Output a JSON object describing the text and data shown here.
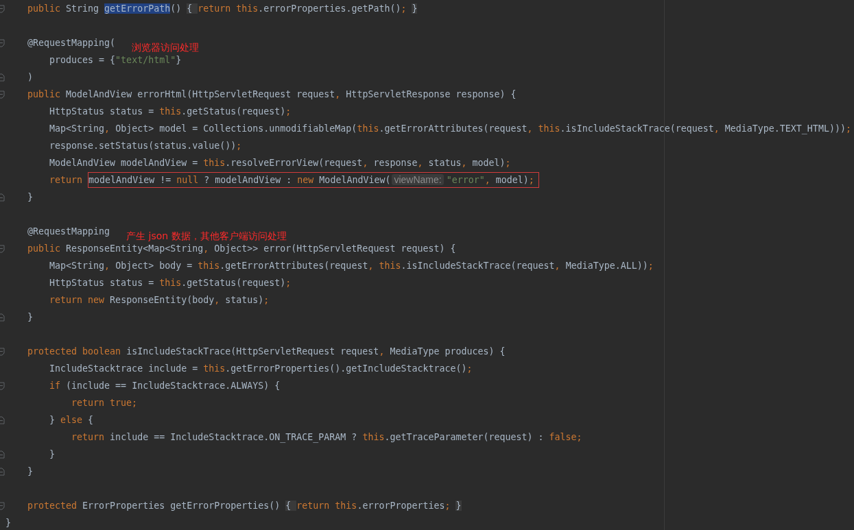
{
  "lines": [
    {
      "kind": "open",
      "segments": [
        {
          "kind": "keyword",
          "text": "    public"
        },
        {
          "kind": "code",
          "text": " String "
        },
        {
          "kind": "selected",
          "text": "getErrorPath"
        },
        {
          "kind": "code",
          "text": "() "
        },
        {
          "kind": "folded",
          "text": "{ "
        },
        {
          "kind": "keyword",
          "text": "return this"
        },
        {
          "kind": "code",
          "text": ".errorProperties.getPath()"
        },
        {
          "kind": "keyword",
          "text": "; "
        },
        {
          "kind": "folded",
          "text": "}"
        }
      ]
    },
    {
      "kind": "open",
      "blank_before": true,
      "segments": [
        {
          "kind": "code",
          "text": "    @RequestMapping("
        }
      ],
      "note": "浏览器访问处理"
    },
    {
      "kind": "plain",
      "segments": [
        {
          "kind": "code",
          "text": "        produces = {"
        },
        {
          "kind": "string",
          "text": "\"text/html\""
        },
        {
          "kind": "code",
          "text": "}"
        }
      ]
    },
    {
      "kind": "close",
      "segments": [
        {
          "kind": "code",
          "text": "    )"
        }
      ]
    },
    {
      "kind": "open",
      "segments": [
        {
          "kind": "keyword",
          "text": "    public"
        },
        {
          "kind": "code",
          "text": " ModelAndView errorHtml(HttpServletRequest request"
        },
        {
          "kind": "keyword",
          "text": ","
        },
        {
          "kind": "code",
          "text": " HttpServletResponse response) {"
        }
      ]
    },
    {
      "kind": "plain",
      "segments": [
        {
          "kind": "code",
          "text": "        HttpStatus status = "
        },
        {
          "kind": "keyword",
          "text": "this"
        },
        {
          "kind": "code",
          "text": ".getStatus(request)"
        },
        {
          "kind": "keyword",
          "text": ";"
        }
      ]
    },
    {
      "kind": "plain",
      "segments": [
        {
          "kind": "code",
          "text": "        Map<String"
        },
        {
          "kind": "keyword",
          "text": ","
        },
        {
          "kind": "code",
          "text": " Object> model = Collections.unmodifiableMap("
        },
        {
          "kind": "keyword",
          "text": "this"
        },
        {
          "kind": "code",
          "text": ".getErrorAttributes(request"
        },
        {
          "kind": "keyword",
          "text": ", this"
        },
        {
          "kind": "code",
          "text": ".isIncludeStackTrace(request"
        },
        {
          "kind": "keyword",
          "text": ","
        },
        {
          "kind": "code",
          "text": " MediaType.TEXT_HTML)))"
        },
        {
          "kind": "keyword",
          "text": ";"
        }
      ]
    },
    {
      "kind": "plain",
      "segments": [
        {
          "kind": "code",
          "text": "        response.setStatus(status.value())"
        },
        {
          "kind": "keyword",
          "text": ";"
        }
      ]
    },
    {
      "kind": "plain",
      "segments": [
        {
          "kind": "code",
          "text": "        ModelAndView modelAndView = "
        },
        {
          "kind": "keyword",
          "text": "this"
        },
        {
          "kind": "code",
          "text": ".resolveErrorView(request"
        },
        {
          "kind": "keyword",
          "text": ","
        },
        {
          "kind": "code",
          "text": " response"
        },
        {
          "kind": "keyword",
          "text": ","
        },
        {
          "kind": "code",
          "text": " status"
        },
        {
          "kind": "keyword",
          "text": ","
        },
        {
          "kind": "code",
          "text": " model)"
        },
        {
          "kind": "keyword",
          "text": ";"
        }
      ]
    },
    {
      "kind": "plain",
      "segments": [
        {
          "kind": "keyword",
          "text": "        return "
        }
      ],
      "box": [
        {
          "kind": "code",
          "text": "modelAndView != "
        },
        {
          "kind": "keyword",
          "text": "null"
        },
        {
          "kind": "code",
          "text": " ? modelAndView : "
        },
        {
          "kind": "keyword",
          "text": "new"
        },
        {
          "kind": "code",
          "text": " ModelAndView("
        },
        {
          "kind": "hint",
          "text": "viewName:"
        },
        {
          "kind": "string",
          "text": "\"error\""
        },
        {
          "kind": "keyword",
          "text": ","
        },
        {
          "kind": "code",
          "text": " model)"
        },
        {
          "kind": "keyword",
          "text": ";"
        }
      ]
    },
    {
      "kind": "close",
      "segments": [
        {
          "kind": "code",
          "text": "    }"
        }
      ]
    },
    {
      "kind": "plain",
      "blank_before": true,
      "segments": [
        {
          "kind": "code",
          "text": "    @RequestMapping"
        }
      ],
      "note": "产生 json 数据，其他客户端访问处理"
    },
    {
      "kind": "open",
      "segments": [
        {
          "kind": "keyword",
          "text": "    public"
        },
        {
          "kind": "code",
          "text": " ResponseEntity<Map<String"
        },
        {
          "kind": "keyword",
          "text": ","
        },
        {
          "kind": "code",
          "text": " Object>> error(HttpServletRequest request) {"
        }
      ]
    },
    {
      "kind": "plain",
      "segments": [
        {
          "kind": "code",
          "text": "        Map<String"
        },
        {
          "kind": "keyword",
          "text": ","
        },
        {
          "kind": "code",
          "text": " Object> body = "
        },
        {
          "kind": "keyword",
          "text": "this"
        },
        {
          "kind": "code",
          "text": ".getErrorAttributes(request"
        },
        {
          "kind": "keyword",
          "text": ", this"
        },
        {
          "kind": "code",
          "text": ".isIncludeStackTrace(request"
        },
        {
          "kind": "keyword",
          "text": ","
        },
        {
          "kind": "code",
          "text": " MediaType.ALL))"
        },
        {
          "kind": "keyword",
          "text": ";"
        }
      ]
    },
    {
      "kind": "plain",
      "segments": [
        {
          "kind": "code",
          "text": "        HttpStatus status = "
        },
        {
          "kind": "keyword",
          "text": "this"
        },
        {
          "kind": "code",
          "text": ".getStatus(request)"
        },
        {
          "kind": "keyword",
          "text": ";"
        }
      ]
    },
    {
      "kind": "plain",
      "segments": [
        {
          "kind": "keyword",
          "text": "        return new"
        },
        {
          "kind": "code",
          "text": " ResponseEntity(body"
        },
        {
          "kind": "keyword",
          "text": ","
        },
        {
          "kind": "code",
          "text": " status)"
        },
        {
          "kind": "keyword",
          "text": ";"
        }
      ]
    },
    {
      "kind": "close",
      "segments": [
        {
          "kind": "code",
          "text": "    }"
        }
      ]
    },
    {
      "kind": "open",
      "blank_before": true,
      "segments": [
        {
          "kind": "keyword",
          "text": "    protected boolean"
        },
        {
          "kind": "code",
          "text": " isIncludeStackTrace(HttpServletRequest request"
        },
        {
          "kind": "keyword",
          "text": ","
        },
        {
          "kind": "code",
          "text": " MediaType produces) {"
        }
      ]
    },
    {
      "kind": "plain",
      "segments": [
        {
          "kind": "code",
          "text": "        IncludeStacktrace include = "
        },
        {
          "kind": "keyword",
          "text": "this"
        },
        {
          "kind": "code",
          "text": ".getErrorProperties().getIncludeStacktrace()"
        },
        {
          "kind": "keyword",
          "text": ";"
        }
      ]
    },
    {
      "kind": "open",
      "segments": [
        {
          "kind": "keyword",
          "text": "        if"
        },
        {
          "kind": "code",
          "text": " (include == IncludeStacktrace.ALWAYS) {"
        }
      ]
    },
    {
      "kind": "plain",
      "segments": [
        {
          "kind": "keyword",
          "text": "            return true;"
        }
      ]
    },
    {
      "kind": "close",
      "segments": [
        {
          "kind": "code",
          "text": "        } "
        },
        {
          "kind": "keyword",
          "text": "else"
        },
        {
          "kind": "code",
          "text": " {"
        }
      ]
    },
    {
      "kind": "plain",
      "segments": [
        {
          "kind": "keyword",
          "text": "            return"
        },
        {
          "kind": "code",
          "text": " include == IncludeStacktrace.ON_TRACE_PARAM ? "
        },
        {
          "kind": "keyword",
          "text": "this"
        },
        {
          "kind": "code",
          "text": ".getTraceParameter(request) : "
        },
        {
          "kind": "keyword",
          "text": "false;"
        }
      ]
    },
    {
      "kind": "close",
      "segments": [
        {
          "kind": "code",
          "text": "        }"
        }
      ]
    },
    {
      "kind": "close",
      "segments": [
        {
          "kind": "code",
          "text": "    }"
        }
      ]
    },
    {
      "kind": "open",
      "blank_before": true,
      "segments": [
        {
          "kind": "keyword",
          "text": "    protected"
        },
        {
          "kind": "code",
          "text": " ErrorProperties getErrorProperties() "
        },
        {
          "kind": "folded",
          "text": "{ "
        },
        {
          "kind": "keyword",
          "text": "return this"
        },
        {
          "kind": "code",
          "text": ".errorProperties"
        },
        {
          "kind": "keyword",
          "text": "; "
        },
        {
          "kind": "folded",
          "text": "}"
        }
      ]
    },
    {
      "kind": "plain",
      "segments": [
        {
          "kind": "code",
          "text": "}"
        }
      ]
    }
  ]
}
